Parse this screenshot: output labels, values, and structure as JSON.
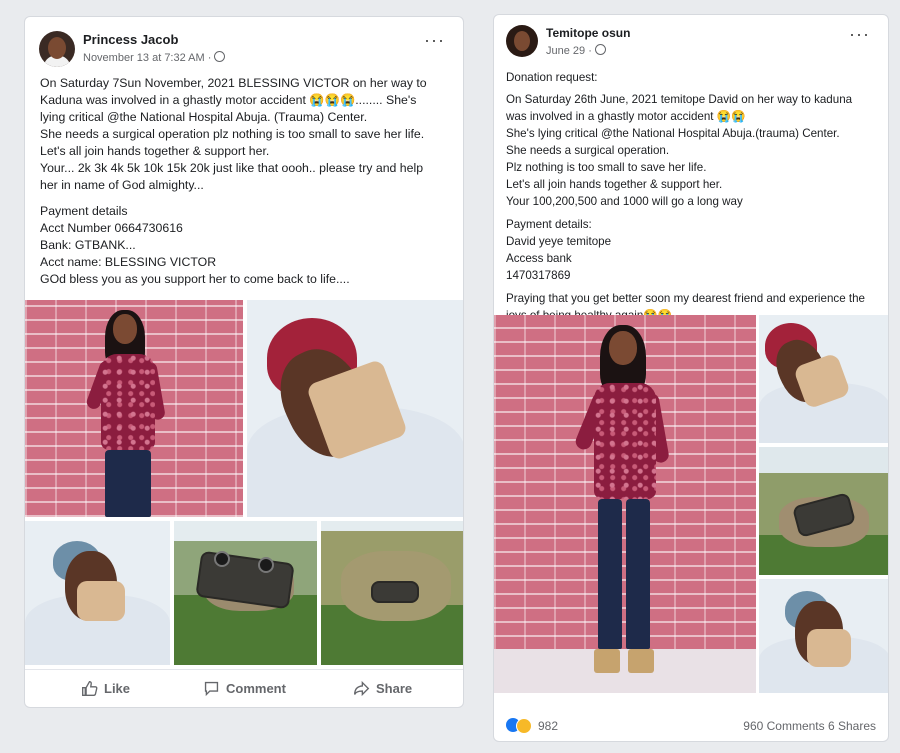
{
  "post1": {
    "author": "Princess Jacob",
    "timestamp": "November 13 at 7:32 AM ·",
    "more_icon": "more-options-icon",
    "lines": [
      "On Saturday 7Sun November, 2021 BLESSING VICTOR on her way to",
      "Kaduna was involved in a ghastly motor accident 😭😭😭........ She's",
      "lying critical @the National Hospital Abuja. (Trauma) Center.",
      "She needs a surgical operation plz nothing is too small to save her life.",
      "Let's all join hands together & support her.",
      "Your... 2k 3k 4k 5k 10k 15k 20k just like that oooh.. please try and help",
      "her in name of God almighty..."
    ],
    "payment_lines": [
      "Payment details",
      "Acct Number 0664730616",
      "Bank: GTBANK...",
      "Acct name: BLESSING VICTOR",
      "GOd bless you as you support her to come back to life...."
    ],
    "actions": {
      "like": "Like",
      "comment": "Comment",
      "share": "Share"
    }
  },
  "post2": {
    "author": "Temitope osun",
    "timestamp": "June 29 ·",
    "more_icon": "more-options-icon",
    "intro": "Donation request:",
    "lines": [
      " On Saturday 26th  June, 2021 temitope David  on her way to kaduna",
      "was involved in a ghastly motor accident 😭😭",
      "She's lying critical @the National Hospital Abuja.(trauma) Center.",
      "She needs a surgical operation.",
      "Plz nothing is too small to save her life.",
      "Let's all join hands together & support her.",
      "Your 100,200,500 and 1000 will go a long way"
    ],
    "payment_lines": [
      "Payment details:",
      "David yeye temitope",
      "Access bank",
      "1470317869"
    ],
    "closing_lines": [
      "Praying that you get better soon my dearest friend and experience the",
      "joys of being healthy again😭😭"
    ],
    "reactions": {
      "count": "982",
      "comments_shares": "960 Comments  6 Shares"
    }
  }
}
